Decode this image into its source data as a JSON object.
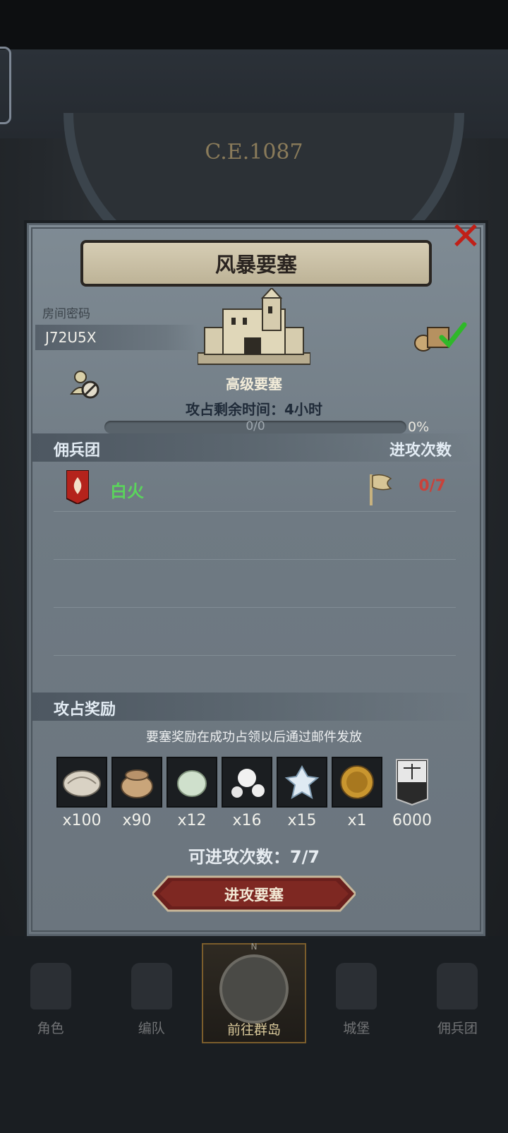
{
  "era": "C.E.1087",
  "dialog": {
    "title": "风暴要塞",
    "room_label": "房间密码",
    "room_code": "J72U5X",
    "fortress_level": "高级要塞",
    "time_label": "攻占剩余时间：",
    "time_value": "4小时",
    "progress": {
      "text": "0/0",
      "percent": "0%",
      "fraction": 0
    },
    "mercenary_section": {
      "title": "佣兵团",
      "right_title": "进攻次数"
    },
    "mercenaries": [
      {
        "name": "白火",
        "attacks": "0/7",
        "name_color": "#5bd45c",
        "count_color": "#c9423a"
      }
    ],
    "reward_section": {
      "title": "攻占奖励",
      "note": "要塞奖励在成功占领以后通过邮件发放"
    },
    "rewards": [
      {
        "icon": "oyster-icon",
        "qty": "x100"
      },
      {
        "icon": "sack-icon",
        "qty": "x90"
      },
      {
        "icon": "pale-stone-icon",
        "qty": "x12"
      },
      {
        "icon": "pearl-icon",
        "qty": "x16"
      },
      {
        "icon": "ice-crystal-icon",
        "qty": "x15"
      },
      {
        "icon": "knight-medal-icon",
        "qty": "x1"
      },
      {
        "icon": "justice-banner-icon",
        "qty": "6000"
      }
    ],
    "attacks_left_label": "可进攻次数：",
    "attacks_left_value": "7/7",
    "attack_button": "进攻要塞"
  },
  "nav": {
    "items": [
      {
        "label": "角色",
        "icon": "character-icon"
      },
      {
        "label": "编队",
        "icon": "formation-icon"
      },
      {
        "label": "前往群岛",
        "icon": "compass-icon",
        "compass_mark": "N"
      },
      {
        "label": "城堡",
        "icon": "castle-icon"
      },
      {
        "label": "佣兵团",
        "icon": "mercenary-icon"
      }
    ]
  },
  "colors": {
    "accent_red": "#c02018",
    "merc_green": "#5bd45c",
    "count_red": "#c9423a"
  }
}
